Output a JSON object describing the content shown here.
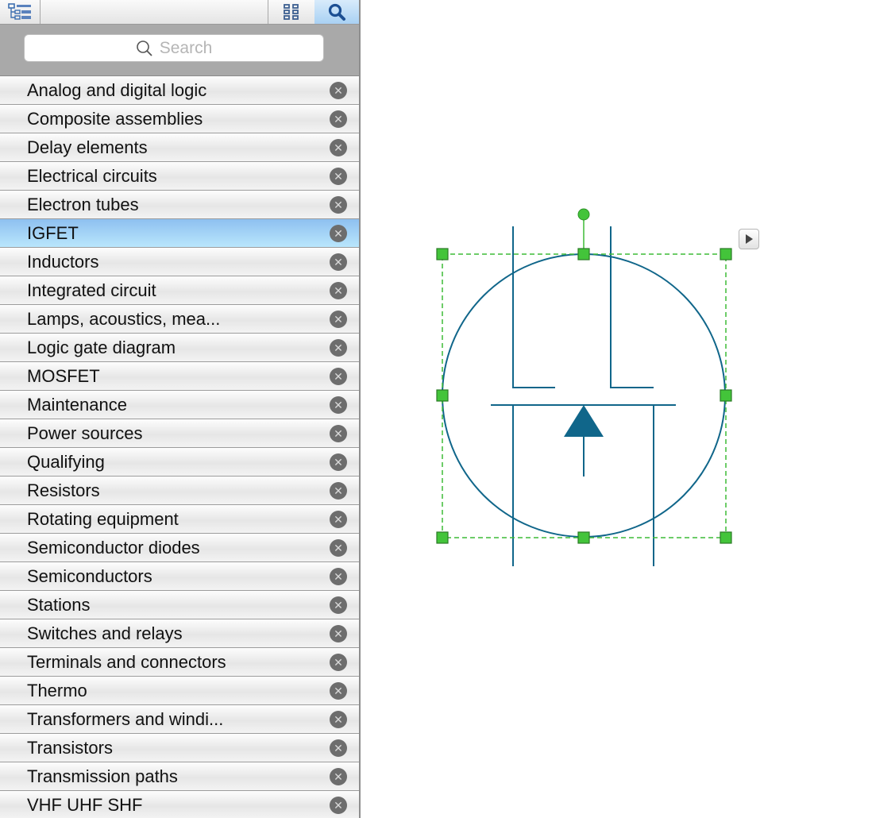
{
  "toolbar": {
    "tree_icon": "tree-view-icon",
    "grid_icon": "grid-view-icon",
    "search_icon": "search-icon"
  },
  "search": {
    "placeholder": "Search"
  },
  "library": {
    "selected": "IGFET",
    "items": [
      {
        "label": "Analog and digital logic"
      },
      {
        "label": "Composite assemblies"
      },
      {
        "label": "Delay elements"
      },
      {
        "label": "Electrical circuits"
      },
      {
        "label": "Electron tubes"
      },
      {
        "label": "IGFET"
      },
      {
        "label": "Inductors"
      },
      {
        "label": "Integrated circuit"
      },
      {
        "label": "Lamps, acoustics, mea..."
      },
      {
        "label": "Logic gate diagram"
      },
      {
        "label": "MOSFET"
      },
      {
        "label": "Maintenance"
      },
      {
        "label": "Power sources"
      },
      {
        "label": "Qualifying"
      },
      {
        "label": "Resistors"
      },
      {
        "label": "Rotating equipment"
      },
      {
        "label": "Semiconductor diodes"
      },
      {
        "label": "Semiconductors"
      },
      {
        "label": "Stations"
      },
      {
        "label": "Switches and relays"
      },
      {
        "label": "Terminals and connectors"
      },
      {
        "label": "Thermo"
      },
      {
        "label": "Transformers and windi..."
      },
      {
        "label": "Transistors"
      },
      {
        "label": "Transmission paths"
      },
      {
        "label": "VHF UHF SHF"
      }
    ]
  },
  "colors": {
    "symbol": "#10668a",
    "selection": "#3dbb36",
    "selected_row": "#a9d7f8"
  }
}
